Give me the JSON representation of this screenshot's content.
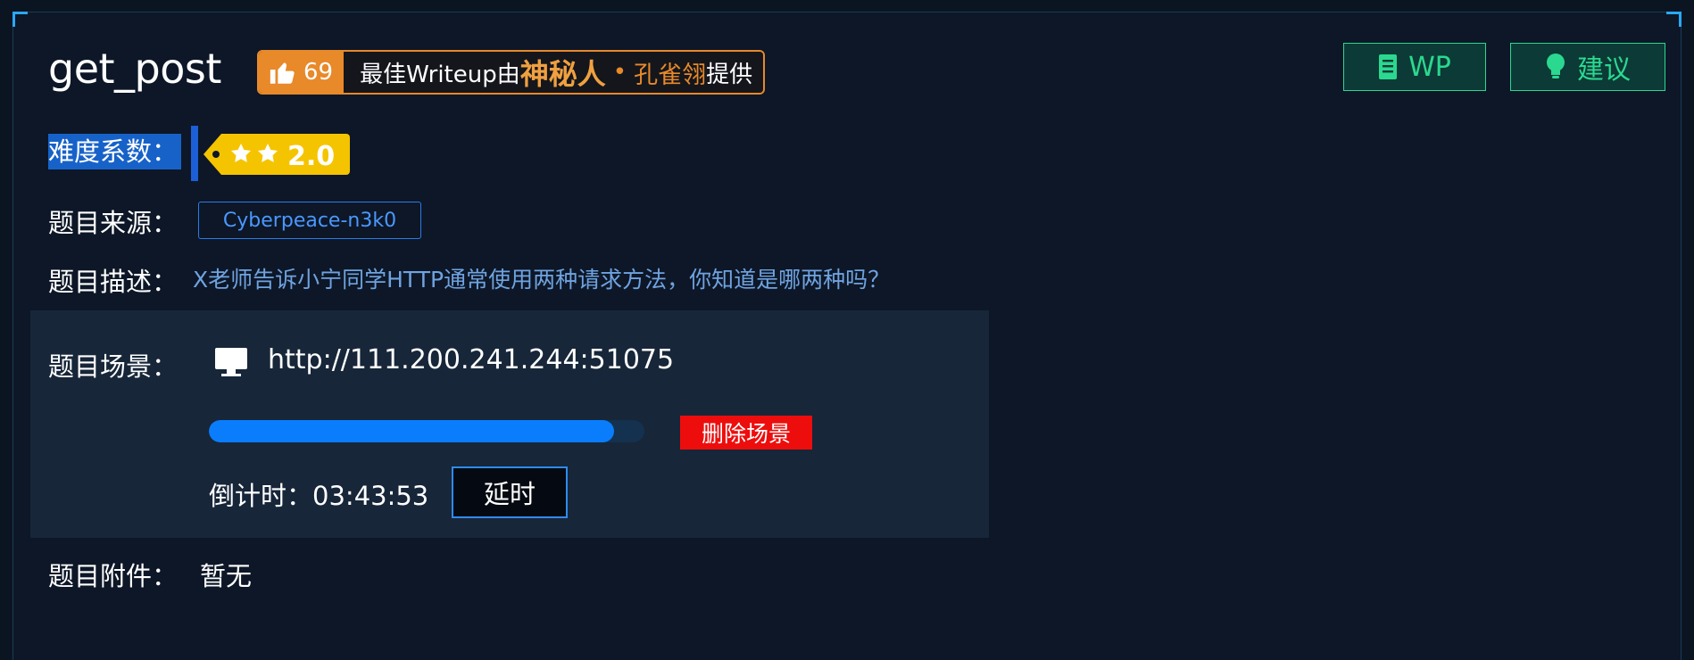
{
  "challenge": {
    "title": "get_post"
  },
  "badge": {
    "likes": "69",
    "prefix": "最佳Writeup由",
    "who": "神秘人",
    "dot": "•",
    "author": "孔雀翎",
    "suffix": "提供",
    "color": "#e8892a"
  },
  "actions": {
    "wp_label": "WP",
    "wp_icon": "document-icon",
    "suggest_label": "建议",
    "suggest_icon": "lightbulb-icon",
    "color": "#2bd88f"
  },
  "difficulty": {
    "label": "难度系数：",
    "stars": 2,
    "value": "2.0",
    "tag_color": "#f5c400"
  },
  "source": {
    "label": "题目来源：",
    "value": "Cyberpeace-n3k0"
  },
  "description": {
    "label": "题目描述：",
    "value": "X老师告诉小宁同学HTTP通常使用两种请求方法，你知道是哪两种吗？"
  },
  "scene": {
    "label": "题目场景：",
    "url": "http://111.200.241.244:51075",
    "icon": "monitor-icon",
    "progress": 0.93,
    "delete_label": "删除场景",
    "countdown_label": "倒计时：",
    "countdown_value": "03:43:53",
    "delay_label": "延时"
  },
  "attachment": {
    "label": "题目附件：",
    "value": "暂无"
  }
}
